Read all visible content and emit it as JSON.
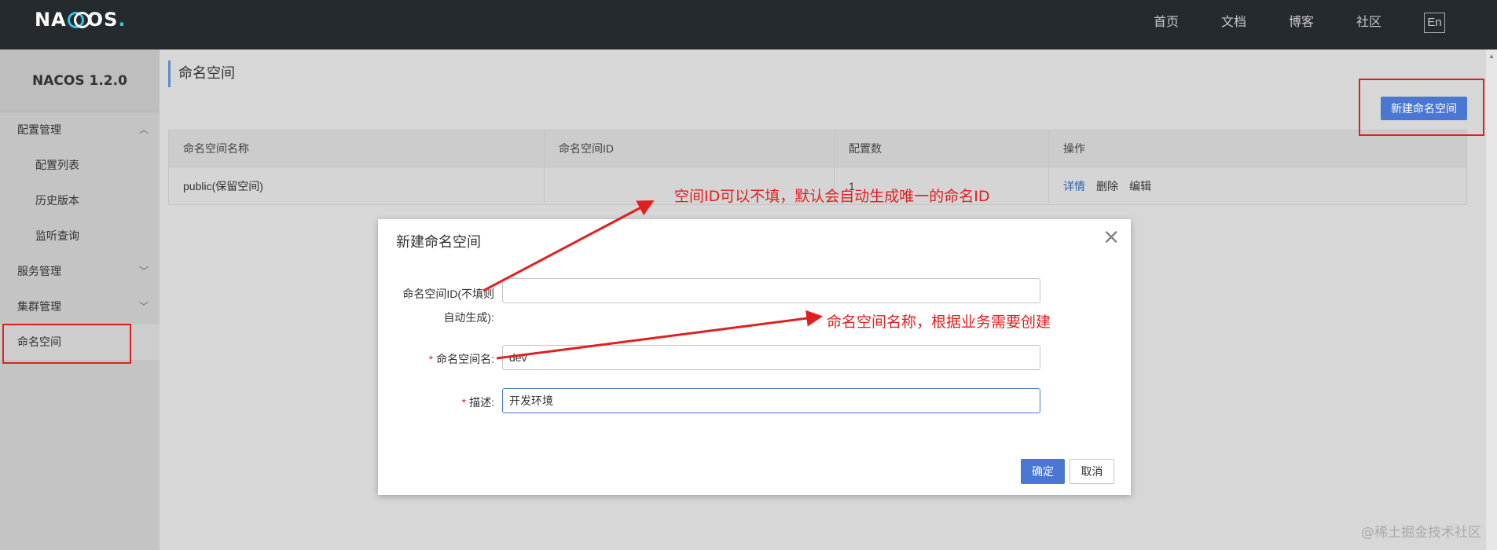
{
  "topbar": {
    "logo_a": "NA",
    "logo_b": "OS",
    "logo_dot": ".",
    "nav": [
      "首页",
      "文档",
      "博客",
      "社区"
    ],
    "lang": "En"
  },
  "sidebar": {
    "version": "NACOS 1.2.0",
    "config_group": "配置管理",
    "config_items": [
      "配置列表",
      "历史版本",
      "监听查询"
    ],
    "service_group": "服务管理",
    "cluster_group": "集群管理",
    "namespace": "命名空间"
  },
  "main": {
    "title": "命名空间",
    "new_button": "新建命名空间",
    "table": {
      "headers": [
        "命名空间名称",
        "命名空间ID",
        "配置数",
        "操作"
      ],
      "rows": [
        {
          "name": "public(保留空间)",
          "id": "",
          "count": "1",
          "actions": [
            "详情",
            "删除",
            "编辑"
          ]
        }
      ]
    }
  },
  "modal": {
    "title": "新建命名空间",
    "close": "✕",
    "id_label_line1": "命名空间ID(不填则",
    "id_label_line2": "自动生成):",
    "id_value": "",
    "name_label": "命名空间名:",
    "name_value": "dev",
    "desc_label": "描述:",
    "desc_value": "开发环境",
    "required_mark": "*",
    "ok": "确定",
    "cancel": "取消"
  },
  "annotations": {
    "id_note": "空间ID可以不填，默认会自动生成唯一的命名ID",
    "name_note": "命名空间名称，根据业务需要创建",
    "color": "#e02020"
  },
  "scrollbar": {
    "arrow": "▲"
  },
  "watermark": "@稀土掘金技术社区"
}
